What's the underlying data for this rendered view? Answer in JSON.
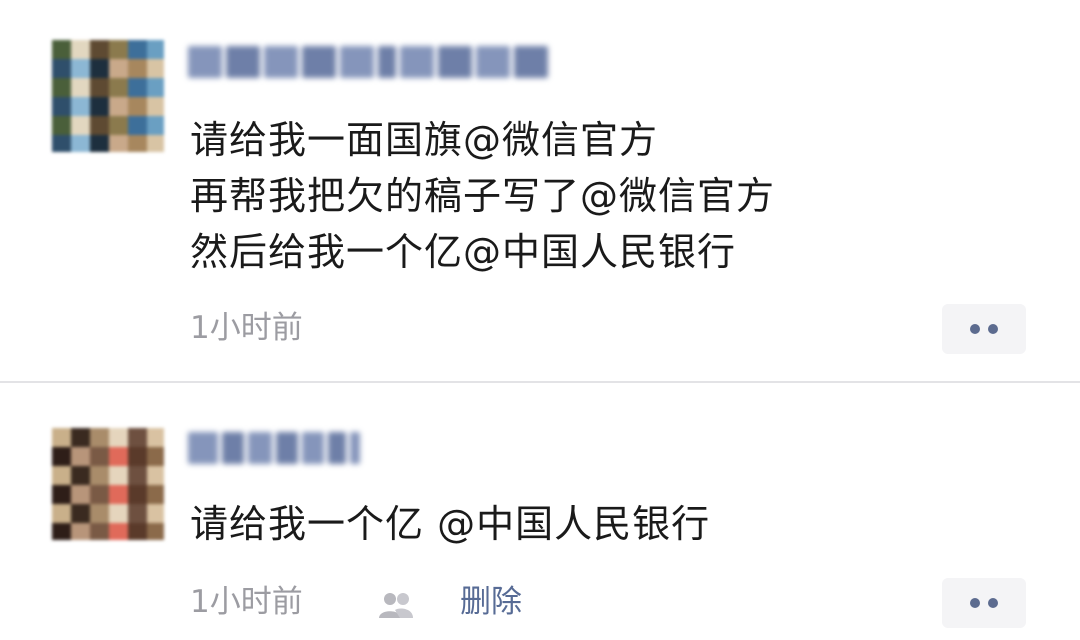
{
  "posts": [
    {
      "username": "",
      "content_lines": [
        "请给我一面国旗@微信官方",
        "再帮我把欠的稿子写了@微信官方",
        "然后给我一个亿@中国人民银行"
      ],
      "time": "1小时前",
      "more_icon": "ellipsis-icon"
    },
    {
      "username": "",
      "content_lines": [
        "请给我一个亿 @中国人民银行"
      ],
      "time": "1小时前",
      "visibility_icon": "friends-icon",
      "delete_label": "删除",
      "more_icon": "ellipsis-icon"
    }
  ],
  "colors": {
    "background": "#ffffff",
    "text": "#1a1a1a",
    "meta_text": "#9c9ca2",
    "link": "#576b95",
    "divider": "#e3e3e6",
    "more_button_bg": "#f4f4f6",
    "more_dots": "#5c6b8f"
  }
}
